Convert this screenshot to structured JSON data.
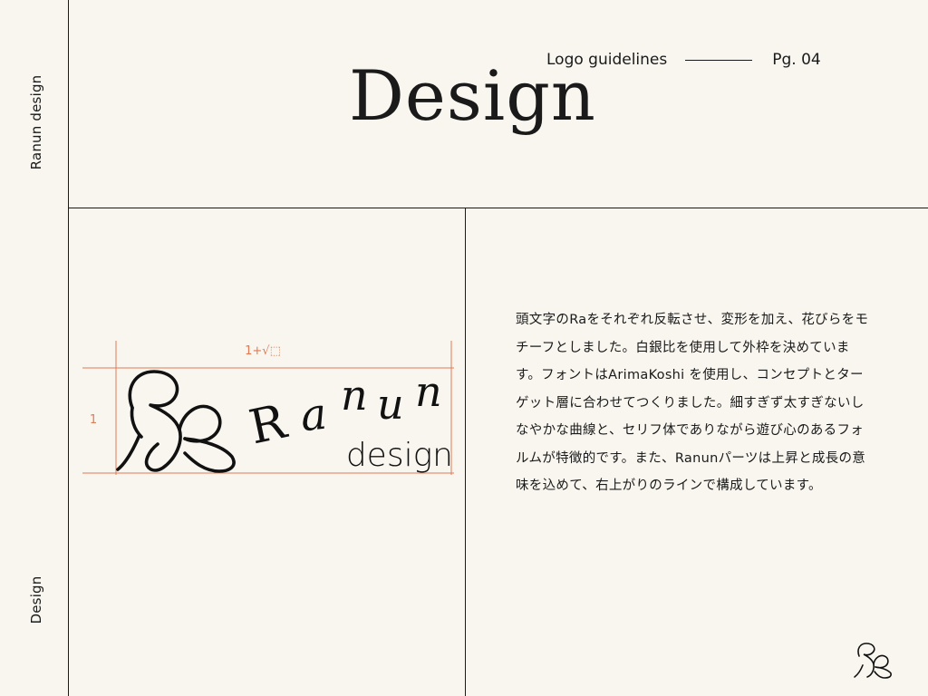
{
  "sidebar": {
    "top_label": "Ranun design",
    "bottom_label": "Design"
  },
  "header": {
    "section": "Logo guidelines",
    "page": "Pg. 04",
    "title": "Design"
  },
  "logo": {
    "wordmark": "Ranun",
    "sub_wordmark": "design",
    "ratio_width_label": "1+√⬚",
    "ratio_height_label": "1",
    "guide_color": "#e07a55"
  },
  "description": "頭文字のRaをそれぞれ反転させ、変形を加え、花びらをモチーフとしました。白銀比を使用して外枠を決めています。フォントはArimaKoshi を使用し、コンセプトとターゲット層に合わせてつくりました。細すぎず太すぎないしなやかな曲線と、セリフ体でありながら遊び心のあるフォルムが特徴的です。また、Ranunパーツは上昇と成長の意味を込めて、右上がりのラインで構成しています。"
}
